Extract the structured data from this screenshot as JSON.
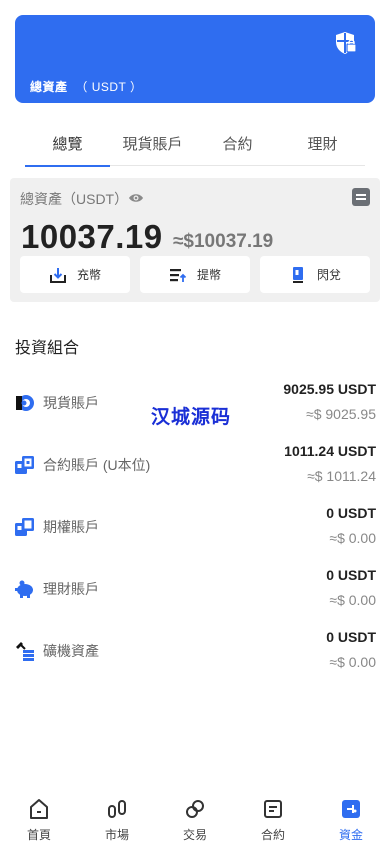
{
  "banner": {
    "title": "總資產",
    "unit": "（ USDT ）",
    "icon": "shield-icon"
  },
  "tabs": [
    {
      "label": "總覽",
      "active": true
    },
    {
      "label": "現貨賬戶",
      "active": false
    },
    {
      "label": "合約",
      "active": false
    },
    {
      "label": "理財",
      "active": false
    }
  ],
  "summary": {
    "label": "總資產（USDT）",
    "amount": "10037.19",
    "approx": "≈$10037.19",
    "actions": [
      {
        "label": "充幣",
        "icon": "deposit-icon"
      },
      {
        "label": "提幣",
        "icon": "withdraw-icon"
      },
      {
        "label": "閃兌",
        "icon": "exchange-icon"
      }
    ]
  },
  "portfolio": {
    "title": "投資組合",
    "accounts": [
      {
        "name": "現貨賬戶",
        "amount": "9025.95 USDT",
        "approx": "≈$ 9025.95",
        "icon": "spot-icon"
      },
      {
        "name": "合約賬戶 (U本位)",
        "amount": "1011.24 USDT",
        "approx": "≈$ 1011.24",
        "icon": "contract-icon"
      },
      {
        "name": "期權賬戶",
        "amount": "0 USDT",
        "approx": "≈$ 0.00",
        "icon": "options-icon"
      },
      {
        "name": "理財賬戶",
        "amount": "0 USDT",
        "approx": "≈$ 0.00",
        "icon": "piggy-bank-icon"
      },
      {
        "name": "礦機資產",
        "amount": "0 USDT",
        "approx": "≈$ 0.00",
        "icon": "mining-icon"
      }
    ]
  },
  "watermark": "汉城源码",
  "nav": [
    {
      "label": "首頁",
      "icon": "home-icon",
      "active": false
    },
    {
      "label": "市場",
      "icon": "market-icon",
      "active": false
    },
    {
      "label": "交易",
      "icon": "trade-icon",
      "active": false
    },
    {
      "label": "合約",
      "icon": "contract-nav-icon",
      "active": false
    },
    {
      "label": "資金",
      "icon": "wallet-icon",
      "active": true
    }
  ],
  "colors": {
    "primary": "#2f6df0",
    "summary_bg": "#f0f0f0",
    "watermark": "#1a2fd6"
  }
}
